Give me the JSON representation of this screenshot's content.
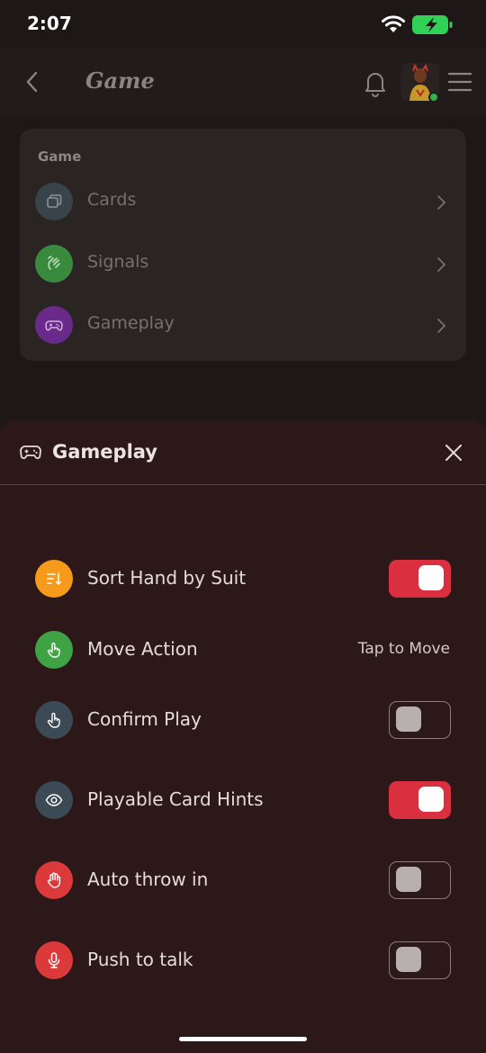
{
  "status_bar": {
    "time": "2:07"
  },
  "nav": {
    "title": "Game"
  },
  "game_card": {
    "section_label": "Game",
    "items": [
      {
        "label": "Cards",
        "icon": "cards-icon",
        "color": "#38444a"
      },
      {
        "label": "Signals",
        "icon": "hand-wave-icon",
        "color": "#3a8a3e"
      },
      {
        "label": "Gameplay",
        "icon": "gamepad-icon",
        "color": "#6a2a8a"
      }
    ]
  },
  "sheet": {
    "title": "Gameplay",
    "settings": [
      {
        "label": "Sort Hand by Suit",
        "icon": "sort-icon",
        "color": "#f59a1b",
        "toggle": true
      },
      {
        "label": "Move Action",
        "icon": "tap-icon",
        "color": "#3fa245",
        "value": "Tap to Move"
      },
      {
        "label": "Confirm Play",
        "icon": "tap-icon",
        "color": "#3c4a55",
        "toggle": false
      },
      {
        "label": "Playable Card Hints",
        "icon": "eye-icon",
        "color": "#3c4a55",
        "toggle": true
      },
      {
        "label": "Auto throw in",
        "icon": "hand-icon",
        "color": "#dc3a3a",
        "toggle": false
      },
      {
        "label": "Push to talk",
        "icon": "microphone-icon",
        "color": "#dc3a3a",
        "toggle": false
      }
    ]
  },
  "colors": {
    "toggle_on": "#d92f3e",
    "sheet_bg": "#2d1819",
    "battery": "#31d158"
  }
}
